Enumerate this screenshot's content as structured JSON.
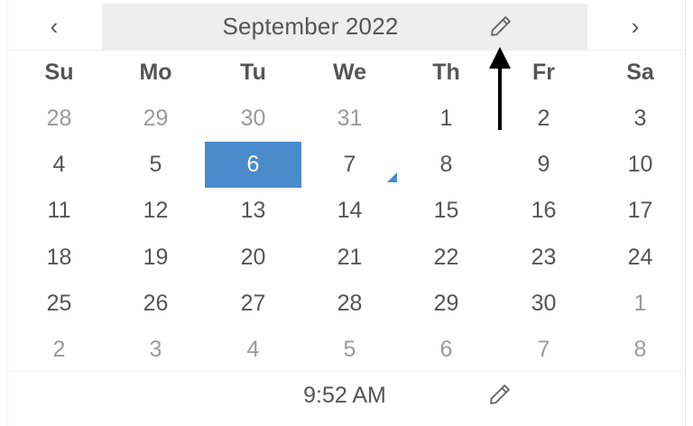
{
  "header": {
    "prev_label": "‹",
    "next_label": "›",
    "month_title": "September 2022",
    "edit_icon": "pencil-icon"
  },
  "weekdays": [
    "Su",
    "Mo",
    "Tu",
    "We",
    "Th",
    "Fr",
    "Sa"
  ],
  "weeks": [
    [
      {
        "d": "28",
        "m": true
      },
      {
        "d": "29",
        "m": true
      },
      {
        "d": "30",
        "m": true
      },
      {
        "d": "31",
        "m": true
      },
      {
        "d": "1"
      },
      {
        "d": "2"
      },
      {
        "d": "3"
      }
    ],
    [
      {
        "d": "4"
      },
      {
        "d": "5"
      },
      {
        "d": "6",
        "sel": true
      },
      {
        "d": "7",
        "today": true
      },
      {
        "d": "8"
      },
      {
        "d": "9"
      },
      {
        "d": "10"
      }
    ],
    [
      {
        "d": "11"
      },
      {
        "d": "12"
      },
      {
        "d": "13"
      },
      {
        "d": "14"
      },
      {
        "d": "15"
      },
      {
        "d": "16"
      },
      {
        "d": "17"
      }
    ],
    [
      {
        "d": "18"
      },
      {
        "d": "19"
      },
      {
        "d": "20"
      },
      {
        "d": "21"
      },
      {
        "d": "22"
      },
      {
        "d": "23"
      },
      {
        "d": "24"
      }
    ],
    [
      {
        "d": "25"
      },
      {
        "d": "26"
      },
      {
        "d": "27"
      },
      {
        "d": "28"
      },
      {
        "d": "29"
      },
      {
        "d": "30"
      },
      {
        "d": "1",
        "m": true
      }
    ],
    [
      {
        "d": "2",
        "m": true
      },
      {
        "d": "3",
        "m": true
      },
      {
        "d": "4",
        "m": true
      },
      {
        "d": "5",
        "m": true
      },
      {
        "d": "6",
        "m": true
      },
      {
        "d": "7",
        "m": true
      },
      {
        "d": "8",
        "m": true
      }
    ]
  ],
  "time": {
    "value": "9:52 AM",
    "edit_icon": "pencil-icon"
  },
  "colors": {
    "selected": "#4a8ccb",
    "muted_text": "#9a9a9a",
    "text": "#555555",
    "header_bg": "#eeeeee"
  }
}
